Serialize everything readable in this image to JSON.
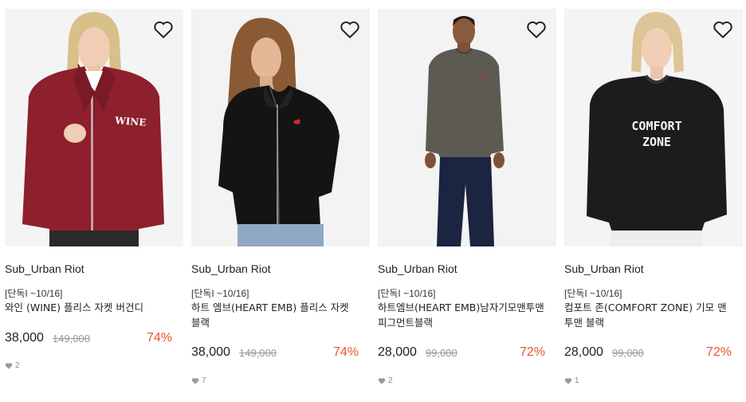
{
  "colors": {
    "discount": "#e8542c",
    "strike": "#999999",
    "text": "#222222"
  },
  "products": [
    {
      "brand": "Sub_Urban Riot",
      "tag": "[단독I ~10/16]",
      "name": "와인 (WINE) 플리스 자켓 버건디",
      "price": "38,000",
      "original_price": "149,000",
      "discount": "74%",
      "likes": "2",
      "image": "burgundy-fleece-jacket-photo"
    },
    {
      "brand": "Sub_Urban Riot",
      "tag": "[단독I ~10/16]",
      "name": "하트 엠브(HEART EMB) 플리스 자켓 블랙",
      "price": "38,000",
      "original_price": "149,000",
      "discount": "74%",
      "likes": "7",
      "image": "black-fleece-jacket-photo"
    },
    {
      "brand": "Sub_Urban Riot",
      "tag": "[단독I ~10/16]",
      "name": "하트엠브(HEART EMB)남자기모맨투맨 피그먼트블랙",
      "price": "28,000",
      "original_price": "99,000",
      "discount": "72%",
      "likes": "2",
      "image": "grey-sweatshirt-photo"
    },
    {
      "brand": "Sub_Urban Riot",
      "tag": "[단독I ~10/16]",
      "name": "컴포트 존(COMFORT ZONE) 기모 맨투맨 블랙",
      "price": "28,000",
      "original_price": "99,000",
      "discount": "72%",
      "likes": "1",
      "image": "comfort-zone-sweatshirt-photo"
    }
  ]
}
